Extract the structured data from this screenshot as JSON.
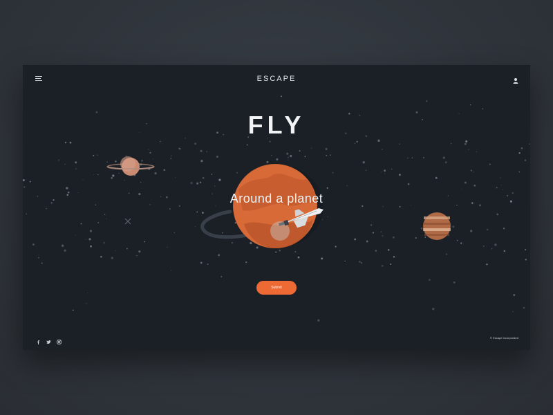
{
  "header": {
    "logo": "ESCAPE"
  },
  "hero": {
    "title": "FLY",
    "subtitle": "Around a  planet",
    "cta_label": "Submit"
  },
  "footer": {
    "copyright": "© Escape Incorporated",
    "social": [
      "facebook-icon",
      "twitter-icon",
      "instagram-icon"
    ]
  },
  "colors": {
    "page_bg": "#2f343b",
    "panel_bg": "#1b2027",
    "accent": "#ee6a35",
    "mars": "#d86a38",
    "jupiter": "#b06a45",
    "saturn": "#c98a72"
  },
  "icons": {
    "menu": "hamburger-menu-icon",
    "user": "user-icon"
  }
}
